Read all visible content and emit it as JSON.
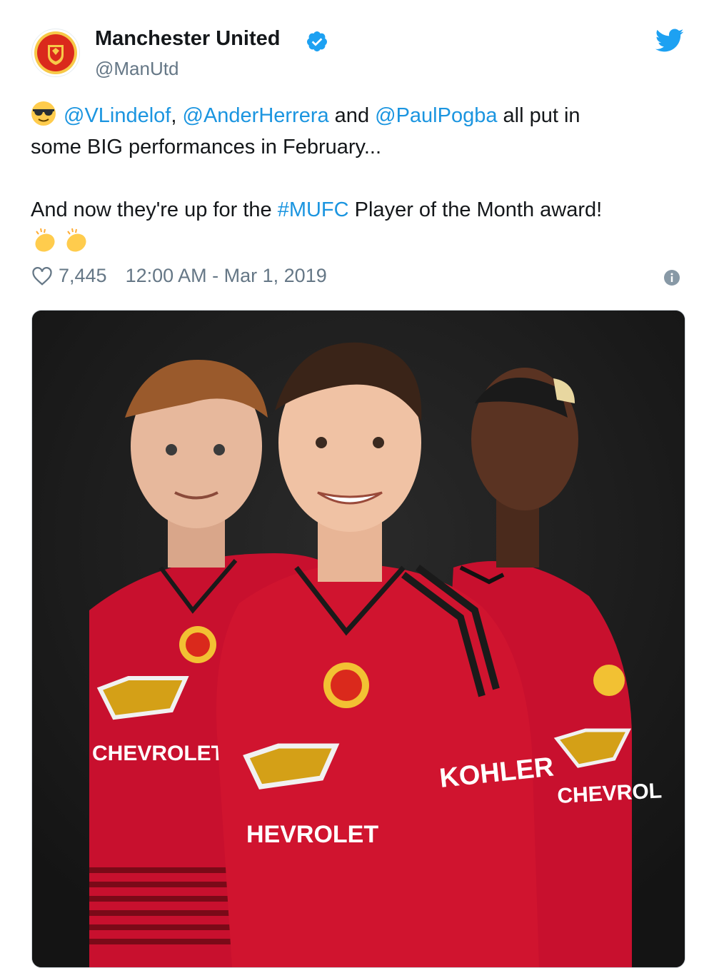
{
  "account": {
    "name": "Manchester United",
    "handle": "@ManUtd",
    "verified_icon": "verified-badge-icon",
    "brand_color": "#1da1f2"
  },
  "tweet": {
    "mention1": "@VLindelof",
    "sep1": ", ",
    "mention2": "@AnderHerrera",
    "sep2": " and ",
    "mention3": "@PaulPogba",
    "text1": " all put in",
    "line2": "some BIG performances in February...",
    "text2a": "And now they're up for the ",
    "hashtag": "#MUFC",
    "text2b": " Player of the Month award!",
    "emoji_start": "sunglasses-emoji",
    "emoji_end": "clapping-hands-emoji"
  },
  "meta": {
    "likes": "7,445",
    "timestamp": "12:00 AM - Mar 1, 2019"
  },
  "photo": {
    "jersey_sponsor_left": "CHEVROLET",
    "jersey_sponsor_center": "HEVROLET",
    "jersey_sleeve": "KOHLER",
    "jersey_sponsor_right": "CHEVROL"
  },
  "colors": {
    "link": "#1b95e0",
    "jersey_red": "#c8102e",
    "background": "#1d1d1d"
  }
}
